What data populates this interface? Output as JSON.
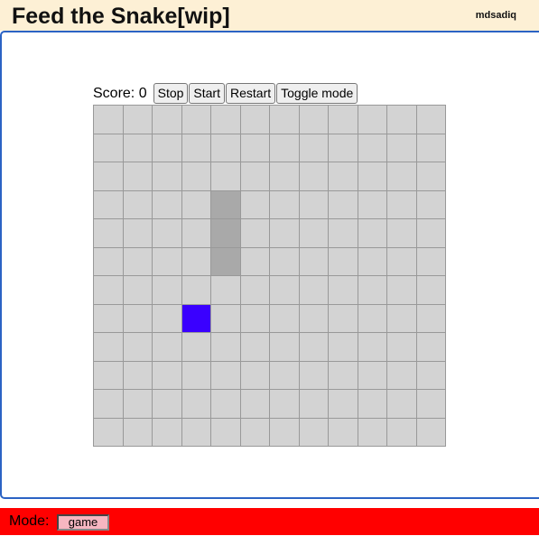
{
  "header": {
    "title": "Feed the Snake[wip]",
    "author": "mdsadiq",
    "background": "#fdf0d5"
  },
  "controls": {
    "score_label": "Score:",
    "score_value": "0",
    "stop_label": "Stop",
    "start_label": "Start",
    "restart_label": "Restart",
    "toggle_label": "Toggle mode"
  },
  "board": {
    "rows": 12,
    "cols": 12,
    "snake_cells": [
      [
        3,
        4
      ],
      [
        4,
        4
      ],
      [
        5,
        4
      ]
    ],
    "food_cell": [
      7,
      3
    ],
    "cell_color": "#d3d3d3",
    "snake_color": "#a9a9a9",
    "food_color": "#3a00ff"
  },
  "footer": {
    "mode_label": "Mode:",
    "mode_value": "game",
    "background": "#ff0000"
  }
}
